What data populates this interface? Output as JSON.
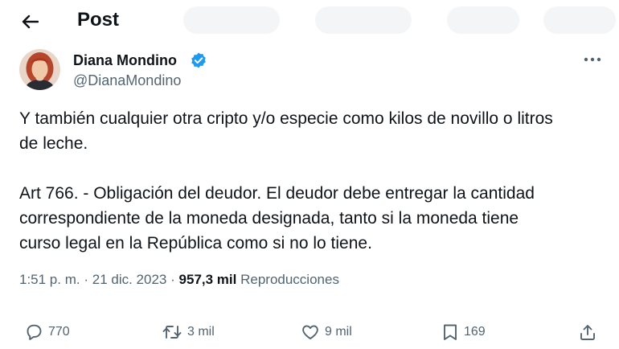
{
  "header": {
    "back_icon": "arrow-left-icon",
    "title": "Post"
  },
  "tweet": {
    "author": {
      "name": "Diana Mondino",
      "handle": "@DianaMondino",
      "verified": true,
      "verified_color": "#1d9bf0"
    },
    "text_lines": [
      "Y también cualquier otra cripto y/o especie como kilos de novillo o litros",
      "de leche.",
      "Art 766. - Obligación del deudor. El deudor debe entregar la cantidad",
      "correspondiente de la moneda designada, tanto si la moneda tiene",
      "curso legal en la República como si no lo tiene."
    ],
    "time": "1:51 p. m.",
    "date": "21 dic. 2023",
    "separator": "·",
    "views_count": "957,3 mil",
    "views_label": "Reproducciones"
  },
  "actions": {
    "replies": "770",
    "reposts": "3 mil",
    "likes": "9 mil",
    "bookmarks": "169"
  },
  "colors": {
    "text": "#0f1419",
    "secondary": "#536471",
    "accent": "#1d9bf0"
  }
}
